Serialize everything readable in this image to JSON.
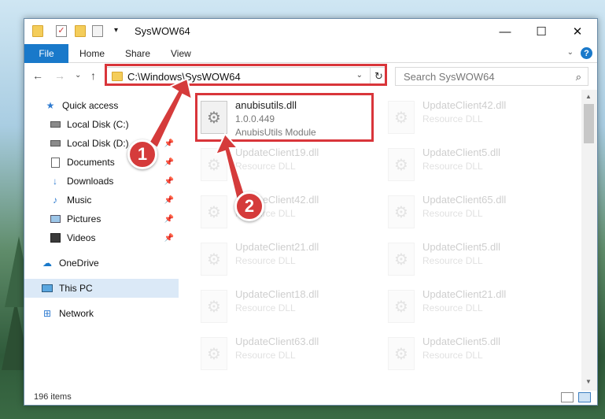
{
  "window": {
    "title": "SysWOW64"
  },
  "ribbon": {
    "tabs": [
      "File",
      "Home",
      "Share",
      "View"
    ],
    "help": "?"
  },
  "address": {
    "path": "C:\\Windows\\SysWOW64"
  },
  "search": {
    "placeholder": "Search SysWOW64"
  },
  "sidebar": {
    "items": [
      {
        "label": "Quick access",
        "icon": "star-icon"
      },
      {
        "label": "Local Disk (C:)",
        "icon": "drive-icon"
      },
      {
        "label": "Local Disk (D:)",
        "icon": "drive-icon"
      },
      {
        "label": "Documents",
        "icon": "documents-icon"
      },
      {
        "label": "Downloads",
        "icon": "download-icon"
      },
      {
        "label": "Music",
        "icon": "music-icon"
      },
      {
        "label": "Pictures",
        "icon": "pictures-icon"
      },
      {
        "label": "Videos",
        "icon": "videos-icon"
      },
      {
        "label": "OneDrive",
        "icon": "cloud-icon"
      },
      {
        "label": "This PC",
        "icon": "computer-icon"
      },
      {
        "label": "Network",
        "icon": "network-icon"
      }
    ]
  },
  "files": {
    "highlighted": {
      "name": "anubisutils.dll",
      "version": "1.0.0.449",
      "description": "AnubisUtils Module"
    },
    "left_column": [
      {
        "name": "UpdateClient19.dll",
        "type": "Resource DLL"
      },
      {
        "name": "UpdateClient42.dll",
        "type": "Resource DLL"
      },
      {
        "name": "UpdateClient21.dll",
        "type": "Resource DLL"
      },
      {
        "name": "UpdateClient18.dll",
        "type": "Resource DLL"
      },
      {
        "name": "UpdateClient63.dll",
        "type": "Resource DLL"
      }
    ],
    "right_column": [
      {
        "name": "UpdateClient42.dll",
        "type": "Resource DLL"
      },
      {
        "name": "UpdateClient5.dll",
        "type": "Resource DLL"
      },
      {
        "name": "UpdateClient65.dll",
        "type": "Resource DLL"
      },
      {
        "name": "UpdateClient5.dll",
        "type": "Resource DLL"
      },
      {
        "name": "UpdateClient21.dll",
        "type": "Resource DLL"
      },
      {
        "name": "UpdateClient5.dll",
        "type": "Resource DLL"
      }
    ]
  },
  "status": {
    "items": "196 items"
  },
  "callouts": [
    "1",
    "2"
  ],
  "colors": {
    "accent": "#1979ca",
    "highlight": "#d9353a",
    "selected": "#dbe9f7"
  }
}
